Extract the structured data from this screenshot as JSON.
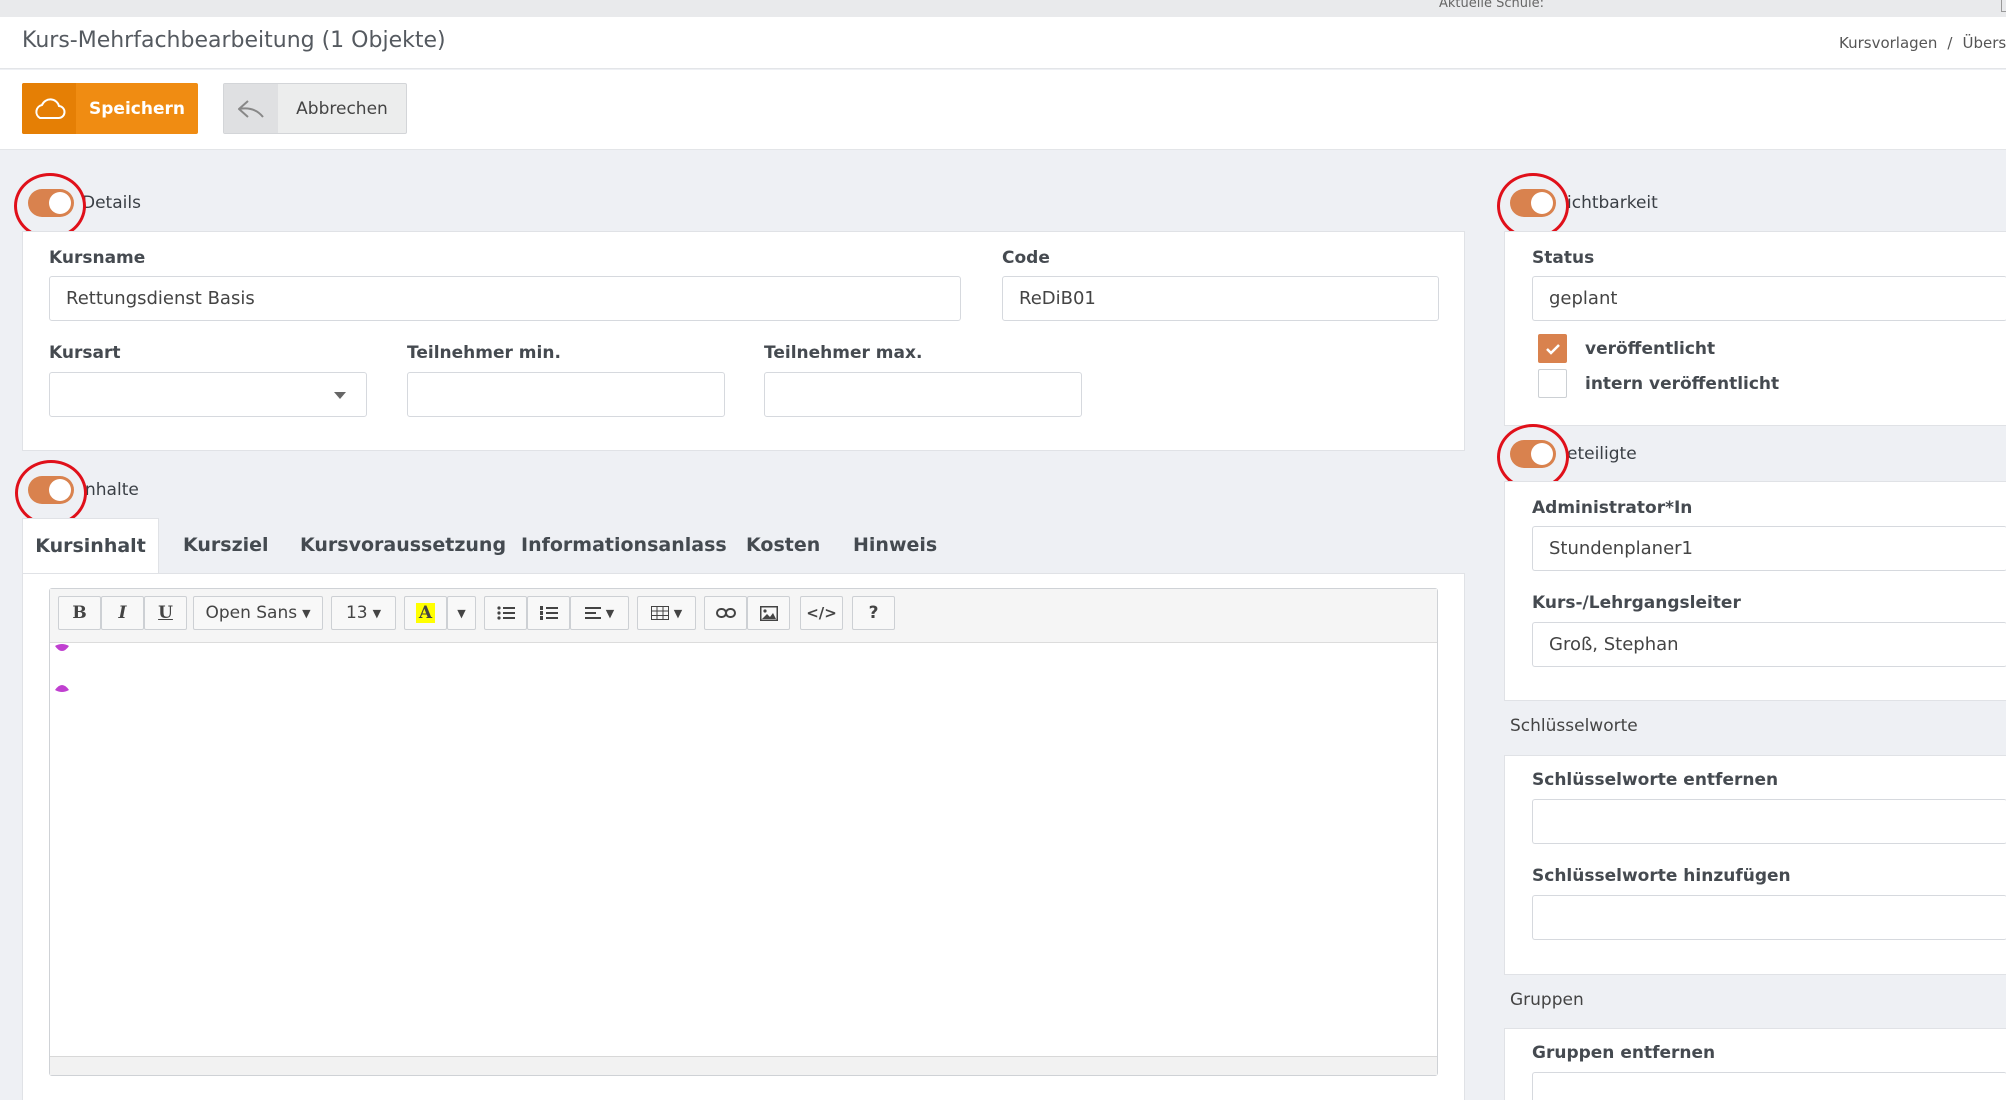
{
  "top": {
    "school_label": "Aktuelle Schule:"
  },
  "header": {
    "title": "Kurs-Mehrfachbearbeitung (1 Objekte)",
    "breadcrumb": [
      "Kursvorlagen",
      "Übersic"
    ],
    "breadcrumb_sep": "/"
  },
  "toolbar": {
    "save_label": "Speichern",
    "cancel_label": "Abbrechen"
  },
  "colors": {
    "accent": "#f08c12",
    "toggle": "#d9824e",
    "highlight_ring": "#e0101a"
  },
  "details": {
    "title": "Details",
    "kursname_label": "Kursname",
    "kursname_value": "Rettungsdienst Basis",
    "code_label": "Code",
    "code_value": "ReDiB01",
    "kursart_label": "Kursart",
    "kursart_value": "",
    "teiln_min_label": "Teilnehmer min.",
    "teiln_min_value": "",
    "teiln_max_label": "Teilnehmer max.",
    "teiln_max_value": ""
  },
  "inhalte": {
    "title": "Inhalte",
    "title_visible": "nhalte",
    "tabs": [
      "Kursinhalt",
      "Kursziel",
      "Kursvoraussetzung",
      "Informationsanlass",
      "Kosten",
      "Hinweis"
    ],
    "active_tab": "Kursinhalt"
  },
  "editor": {
    "bold": "B",
    "italic": "I",
    "underline": "U",
    "font": "Open Sans",
    "size": "13",
    "color_letter": "A",
    "code": "</>",
    "help": "?"
  },
  "sichtbarkeit": {
    "title": "Sichtbarkeit",
    "title_visible": "ichtbarkeit",
    "status_label": "Status",
    "status_value": "geplant",
    "cb1_label": "veröffentlicht",
    "cb1_checked": true,
    "cb2_label": "intern veröffentlicht",
    "cb2_checked": false
  },
  "beteiligte": {
    "title": "Beteiligte",
    "title_visible": "eteiligte",
    "admin_label": "Administrator*In",
    "admin_value": "Stundenplaner1",
    "leiter_label": "Kurs-/Lehrgangsleiter",
    "leiter_value": "Groß, Stephan"
  },
  "schluesselworte": {
    "title": "Schlüsselworte",
    "remove_label": "Schlüsselworte entfernen",
    "add_label": "Schlüsselworte hinzufügen"
  },
  "gruppen": {
    "title": "Gruppen",
    "remove_label": "Gruppen entfernen"
  }
}
